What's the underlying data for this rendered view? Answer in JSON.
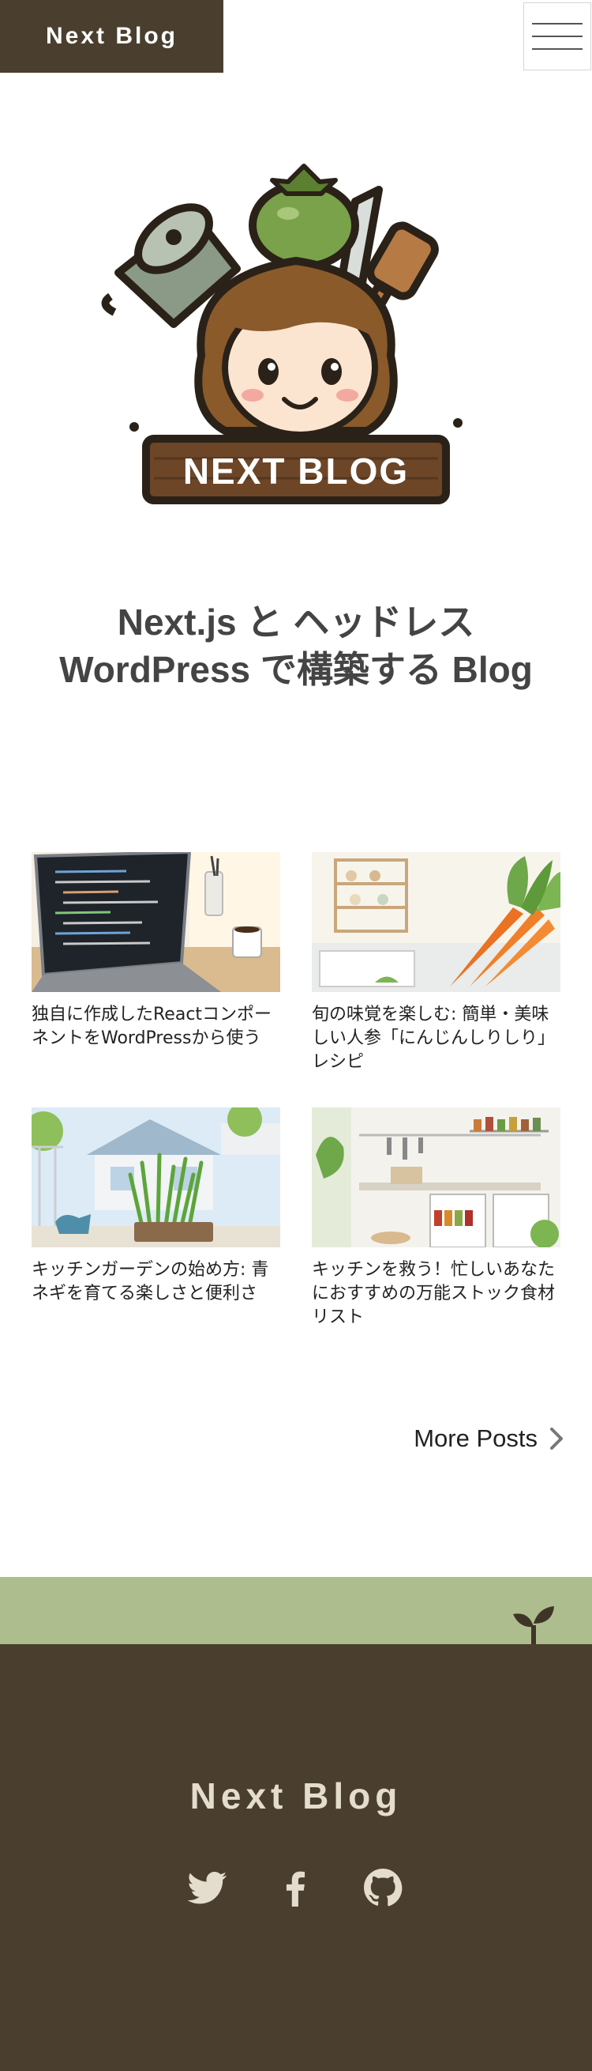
{
  "header": {
    "site_title": "Next Blog",
    "menu_icon": "hamburger-menu-icon"
  },
  "hero": {
    "logo_text": "NEXT BLOG",
    "title_line1": "Next.js と ヘッドレス",
    "title_line2": "WordPress で構築する Blog"
  },
  "posts": [
    {
      "title": "独自に作成したReactコンポーネントをWordPressから使う",
      "thumbnail": "laptop-with-code"
    },
    {
      "title": "旬の味覚を楽しむ: 簡単・美味しい人参「にんじんしりしり」レシピ",
      "thumbnail": "carrots-in-kitchen"
    },
    {
      "title": "キッチンガーデンの始め方: 青ネギを育てる楽しさと便利さ",
      "thumbnail": "green-onions-on-balcony"
    },
    {
      "title": "キッチンを救う！忙しいあなたにおすすめの万能ストック食材リスト",
      "thumbnail": "kitchen-pantry-shelves"
    }
  ],
  "more_posts": {
    "label": "More Posts"
  },
  "footer": {
    "title": "Next Blog",
    "social": [
      "twitter-icon",
      "facebook-icon",
      "github-icon"
    ]
  },
  "colors": {
    "brand_dark": "#4a3f2f",
    "accent_green": "#aebd8e",
    "footer_text": "#e4dccd"
  }
}
